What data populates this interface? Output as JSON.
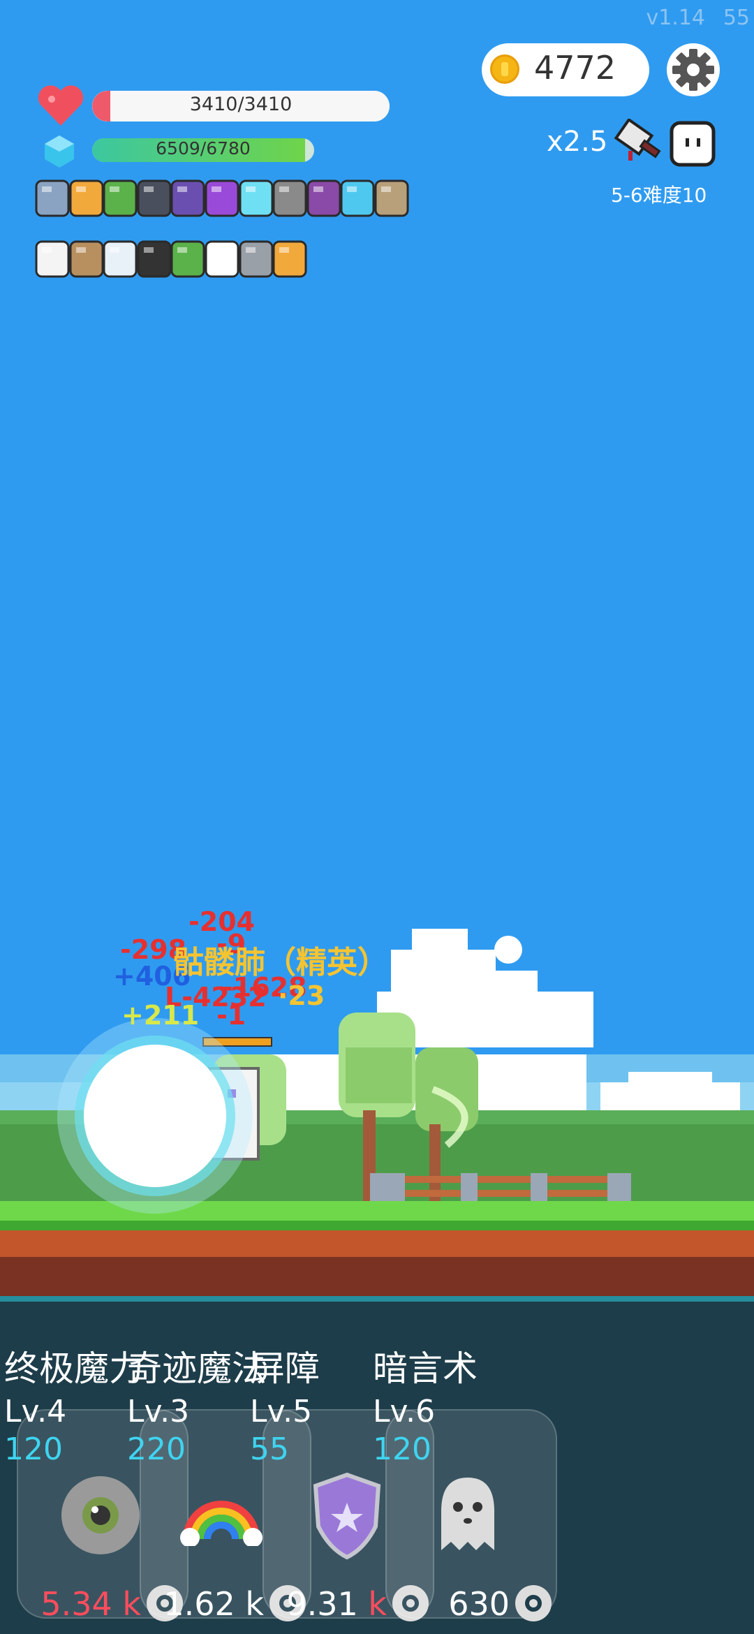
{
  "header": {
    "version": "v1.14",
    "fps": "55"
  },
  "currency": {
    "gold": "4772"
  },
  "player": {
    "hp_text": "3410/3410",
    "hp": 3410,
    "hp_max": 3410,
    "mp_text": "6509/6780",
    "mp": 6509,
    "mp_max": 6780
  },
  "battle": {
    "multiplier": "x2.5",
    "stage": "5-6难度10"
  },
  "items_row1": [
    "shield-icon",
    "book-icon",
    "tree-icon",
    "skull-book-icon",
    "wizard-hat-icon",
    "crystal-ball-icon",
    "diamond-icon",
    "axe-icon",
    "spell-book-icon",
    "ice-gem-icon",
    "dagger-icon"
  ],
  "items_row2": [
    "dice-icon",
    "bullets-icon",
    "speed-lines-icon",
    "cauldron-icon",
    "plant-icon",
    "egg-icon",
    "tombstone-icon",
    "book-icon"
  ],
  "enemy": {
    "name": "骷髅肺（精英）"
  },
  "damage_numbers": [
    {
      "text": "-204",
      "color": "#e63030"
    },
    {
      "text": "-9",
      "color": "#e63030"
    },
    {
      "text": "-298",
      "color": "#e63030"
    },
    {
      "text": "+406",
      "color": "#2060e0"
    },
    {
      "text": "-1628",
      "color": "#e63030"
    },
    {
      "text": "L-4232",
      "color": "#e63030"
    },
    {
      "text": "·23",
      "color": "#f5c431"
    },
    {
      "text": "+211",
      "color": "#d8e84a"
    },
    {
      "text": "-1",
      "color": "#e63030"
    }
  ],
  "skills": [
    {
      "name": "终极魔力",
      "level": "Lv.4",
      "cost": "120",
      "value": "5.34",
      "unit": "k",
      "value_color": "#ff4d5e"
    },
    {
      "name": "奇迹魔法",
      "level": "Lv.3",
      "cost": "220",
      "value": "1.62",
      "unit": "k",
      "value_color": "#ffffff"
    },
    {
      "name": "屏障",
      "level": "Lv.5",
      "cost": "55",
      "value": "9.31",
      "unit": "k",
      "value_color": "#ffffff"
    },
    {
      "name": "暗言术",
      "level": "Lv.6",
      "cost": "120",
      "value": "630",
      "unit": "",
      "value_color": "#ffffff"
    }
  ],
  "colors": {
    "sky": "#2f9bf0",
    "panel": "#1e3d4a",
    "gold": "#f5b515",
    "hp": "#ef5a6a",
    "mp": "#6fd44a"
  }
}
